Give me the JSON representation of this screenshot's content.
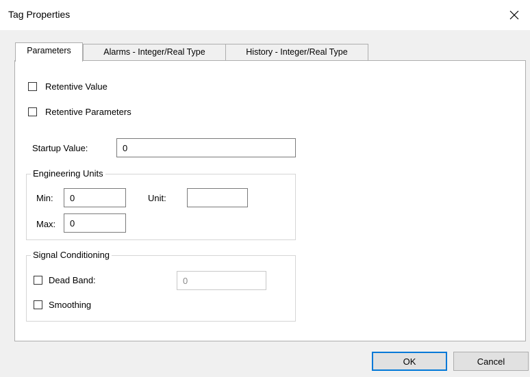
{
  "window": {
    "title": "Tag Properties",
    "close_glyph": "✕"
  },
  "tabs": [
    {
      "label": "Parameters",
      "active": true
    },
    {
      "label": "Alarms - Integer/Real Type",
      "active": false
    },
    {
      "label": "History - Integer/Real Type",
      "active": false
    }
  ],
  "parameters": {
    "retentive_value": {
      "label": "Retentive Value",
      "checked": false
    },
    "retentive_parameters": {
      "label": "Retentive Parameters",
      "checked": false
    },
    "startup_value": {
      "label": "Startup Value:",
      "value": "0"
    },
    "engineering_units": {
      "title": "Engineering Units",
      "min_label": "Min:",
      "min_value": "0",
      "max_label": "Max:",
      "max_value": "0",
      "unit_label": "Unit:",
      "unit_value": ""
    },
    "signal_conditioning": {
      "title": "Signal Conditioning",
      "dead_band": {
        "label": "Dead Band:",
        "checked": false,
        "value": "0"
      },
      "smoothing": {
        "label": "Smoothing",
        "checked": false
      }
    }
  },
  "buttons": {
    "ok_label": "OK",
    "cancel_label": "Cancel"
  },
  "colors": {
    "default_button_border": "#0078d7",
    "panel_background": "#ffffff",
    "dialog_background": "#f0f0f0"
  }
}
